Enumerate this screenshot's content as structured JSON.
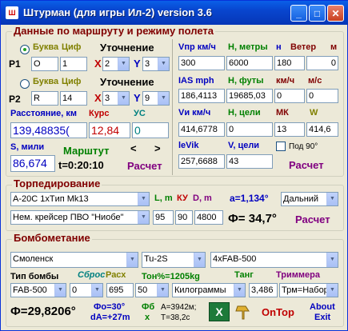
{
  "window": {
    "title": "Штурман (для игры Ил-2) version 3.6",
    "icon_text": "Ш"
  },
  "route": {
    "title": "Данные по маршруту и режиму полета",
    "bukva": "Буква",
    "cifr": "Циф",
    "utochnenie": "Уточнение",
    "p1": {
      "label": "P1",
      "letter": "O",
      "number": "1",
      "x_label": "X",
      "x_value": "2",
      "y_label": "Y",
      "y_value": "3"
    },
    "p2": {
      "label": "P2",
      "letter": "R",
      "number": "14",
      "x_label": "X",
      "x_value": "3",
      "y_label": "Y",
      "y_value": "9"
    },
    "dist_label": "Расстояние, км",
    "dist_value": "139,48835(",
    "course_label": "Курс",
    "course_value": "12,84",
    "yc_label": "УС",
    "yc_value": "0",
    "smiles_label": "S, мили",
    "smiles_value": "86,674",
    "marshrut_label": "Марштут",
    "time_value": "t=0:20:10",
    "prev": "<",
    "next": ">",
    "calc_label": "Расчет",
    "vpr_label": "Vпр км/ч",
    "vpr_value": "300",
    "h_m_label": "H, метры",
    "h_m_value": "6000",
    "n_label": "н",
    "n_value": "180",
    "wind_label": "Ветер",
    "wind_m_label": "м",
    "wind_value": "0",
    "ias_label": "IAS mph",
    "ias_value": "186,4113",
    "h_ft_label": "H, футы",
    "h_ft_value": "19685,03",
    "kmh_label": "км/ч",
    "kmh_value": "0",
    "ms_label": "м/с",
    "ms_value": "0",
    "vi_label": "Vи км/ч",
    "vi_value": "414,6778",
    "h_target_label": "H, цели",
    "h_target_value": "0",
    "mk_label": "МК",
    "mk_value": "13",
    "w_label": "W",
    "w_value": "414,6",
    "levik_label": "leVik",
    "levik_value": "257,6688",
    "v_target_label": "V, цели",
    "v_target_value": "43",
    "pod90_label": "Под 90°",
    "calc2_label": "Расчет"
  },
  "torpedo": {
    "title": "Торпедирование",
    "torpedo_select": "A-20C 1xTип Mk13",
    "target_select": "Нем. крейсер ПВО \"Ниобе\"",
    "l_label": "L, m",
    "l_value": "95",
    "ky_label": "КУ",
    "ky_value": "90",
    "d_label": "D, m",
    "d_value": "4800",
    "alpha_label": "a=1,134°",
    "range_select": "Дальний",
    "phi_value": "Ф= 34,7°",
    "calc_label": "Расчет"
  },
  "bomb": {
    "title": "Бомбометание",
    "city_select": "Смоленск",
    "plane_select": "Tu-2S",
    "load_select": "4xFAB-500",
    "type_label": "Тип бомбы",
    "sbros_label": "Сброс",
    "rash_label": "Расх",
    "ton_label": "Тон%=1205kg",
    "tang_label": "Танг",
    "trim_label": "Триммера",
    "bomb_select": "FAB-500",
    "sbros_select": "0",
    "rash_value": "695",
    "fifty_select": "50",
    "unit_select": "Килограммы",
    "tang_value": "3,486",
    "trim_select": "Трм=Набор",
    "phi_value": "Ф=29,8206°",
    "phi0_value": "Фо=30°",
    "da_value": "dA=+27m",
    "phib_label": "Фб",
    "x_label": "x",
    "a_value": "A=3942м;",
    "t_value": "T=38,2c",
    "ontop_label": "OnTop",
    "about_label": "About",
    "exit_label": "Exit"
  }
}
